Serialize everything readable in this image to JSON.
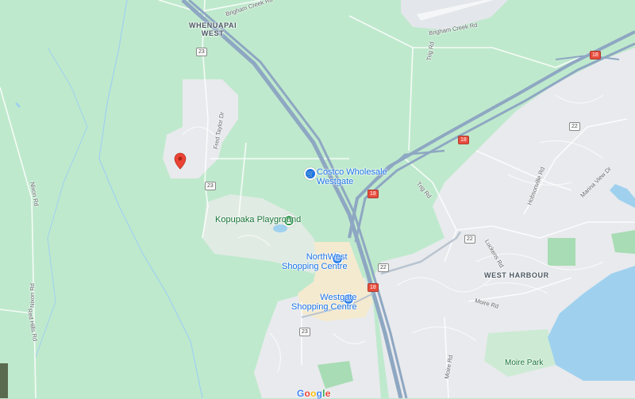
{
  "places": {
    "whenuapai_west": "WHENUAPAI\nWEST",
    "west_harbour": "WEST HARBOUR",
    "costco": "Costco Wholesale\nWestgate",
    "kopupaka": "Kopupaka Playground",
    "northwest": "NorthWest\nShopping Centre",
    "westgate": "Westgate\nShopping Centre",
    "moire_park": "Moire Park"
  },
  "roads": {
    "brigham_creek_top": "Brigham Creek Rd",
    "brigham_creek_right": "Brigham Creek Rd",
    "trig_rd_top": "Trig Rd",
    "trig_rd_mid": "Trig Rd",
    "fred_taylor": "Fred Taylor Dr",
    "nixon_rd_left": "Nixon Rd",
    "nixon_rd_bottom": "Nixon Rd",
    "red_hills": "Red Hills Rd",
    "hobsonville": "Hobsonville Rd",
    "marina_view": "Marina View Dr",
    "luckens": "Luckens Rd",
    "moire_rd": "Moire Rd",
    "moire_rd2": "Moire Rd"
  },
  "shields": {
    "r23a": "23",
    "r23b": "23",
    "r23c": "23",
    "r18a": "18",
    "r18b": "18",
    "r18c": "18",
    "r18d": "18",
    "r22a": "22",
    "r22b": "22",
    "r22c": "22"
  },
  "icons": {
    "marker": "red-location-pin",
    "costco": "shopping-cart-icon",
    "kopupaka": "park-tree-icon",
    "northwest": "shopping-bag-icon",
    "westgate": "shopping-bag-icon"
  },
  "colors": {
    "land": "#bfe9cd",
    "urban": "#e8eaed",
    "commercial": "#f4ead0",
    "water": "#9fd1ef",
    "motorway": "#8ea7c2",
    "marker": "#ea4335"
  },
  "logo": "Google"
}
